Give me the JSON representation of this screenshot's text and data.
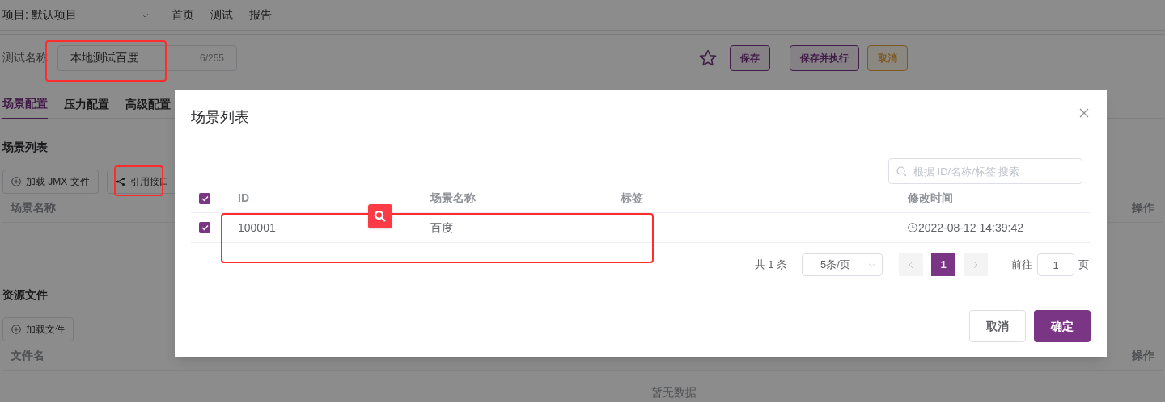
{
  "header": {
    "project_selector": "项目: 默认项目",
    "nav": [
      {
        "label": "首页",
        "selected": false
      },
      {
        "label": "测试",
        "selected": false
      },
      {
        "label": "报告",
        "selected": false
      }
    ]
  },
  "test_name": {
    "label": "测试名称",
    "value": "本地测试百度",
    "counter": "6/255"
  },
  "actions": [
    {
      "label": "保存",
      "kind": "primary"
    },
    {
      "label": "保存并执行",
      "kind": "primary"
    },
    {
      "label": "取消",
      "kind": "warning"
    }
  ],
  "tabs": [
    {
      "label": "场景配置",
      "selected": true
    },
    {
      "label": "压力配置",
      "selected": false
    },
    {
      "label": "高级配置",
      "selected": false
    }
  ],
  "scene_section": {
    "title": "场景列表",
    "buttons": [
      {
        "label": "加载 JMX 文件",
        "kind": "plus"
      },
      {
        "label": "引用接口",
        "kind": "share"
      }
    ],
    "columns": [
      "场景名称",
      "操作"
    ]
  },
  "resource_section": {
    "title": "资源文件",
    "buttons": [
      {
        "label": "加载文件",
        "kind": "plus"
      }
    ],
    "columns": [
      "文件名",
      "操作"
    ],
    "empty_text": "暂无数据"
  },
  "dialog": {
    "title": "场景列表",
    "search": {
      "placeholder": "根据 ID/名称/标签 搜索"
    },
    "all_checked": true,
    "columns": [
      "ID",
      "场景名称",
      "标签",
      "修改时间"
    ],
    "rows": [
      {
        "checked": true,
        "id": "100001",
        "name": "百度",
        "tag": "",
        "time": "2022-08-12 14:39:42"
      }
    ],
    "pagination": {
      "total": "共 1 条",
      "page_size": "5条/页",
      "pages": [
        {
          "label": "1",
          "selected": true
        }
      ],
      "goto_label": "前往",
      "goto_value": "1",
      "goto_suffix": "页"
    },
    "buttons": [
      {
        "label": "取消",
        "kind": "default"
      },
      {
        "label": "确定",
        "kind": "primary"
      }
    ]
  }
}
